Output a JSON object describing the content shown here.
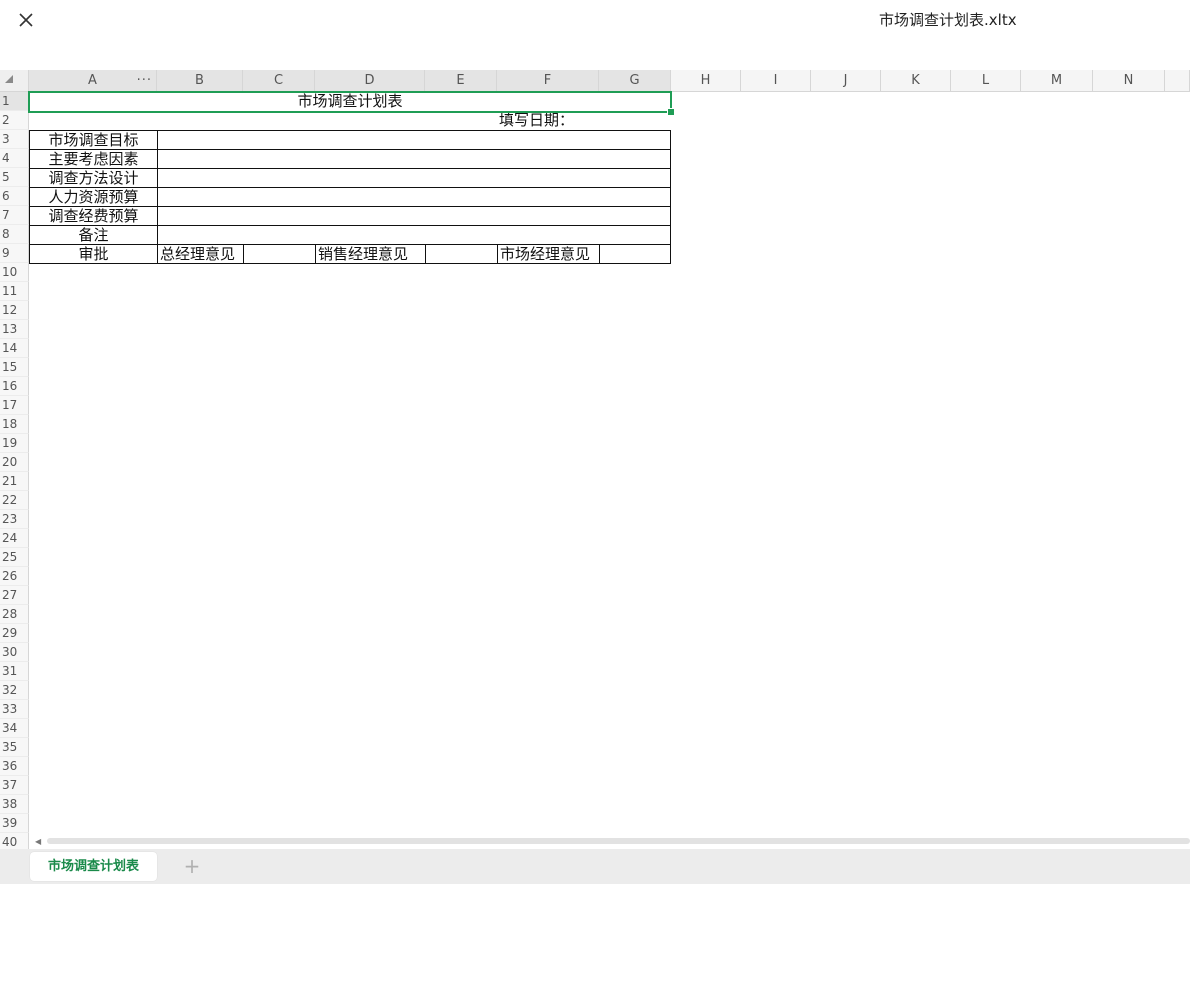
{
  "window": {
    "file_title": "市场调查计划表.xltx",
    "close_icon": "close-icon"
  },
  "grid": {
    "columns": [
      "A",
      "",
      "B",
      "C",
      "D",
      "E",
      "F",
      "G",
      "H",
      "I",
      "J",
      "K",
      "L",
      "M",
      "N"
    ],
    "col_a_menu": "···",
    "rows": [
      "1",
      "2",
      "3",
      "4",
      "5",
      "6",
      "7",
      "8",
      "9",
      "10",
      "11",
      "12",
      "13",
      "14",
      "15",
      "16",
      "17",
      "18",
      "19",
      "20",
      "21",
      "22",
      "23",
      "24",
      "25",
      "26",
      "27",
      "28",
      "29",
      "30",
      "31",
      "32",
      "33",
      "34",
      "35",
      "36",
      "37",
      "38",
      "39",
      "40"
    ]
  },
  "sheet": {
    "title": "市场调查计划表",
    "date_label": "填写日期：",
    "labels": [
      "市场调查目标",
      "主要考虑因素",
      "调查方法设计",
      "人力资源预算",
      "调查经费预算",
      "备注"
    ],
    "approval_label": "审批",
    "gm_opinion": "总经理意见",
    "sales_opinion": "销售经理意见",
    "market_opinion": "市场经理意见"
  },
  "tabs": {
    "active": "市场调查计划表",
    "add_icon": "plus-icon"
  },
  "colors": {
    "selection": "#1f9d55",
    "active_tab_text": "#1a8a4a"
  }
}
